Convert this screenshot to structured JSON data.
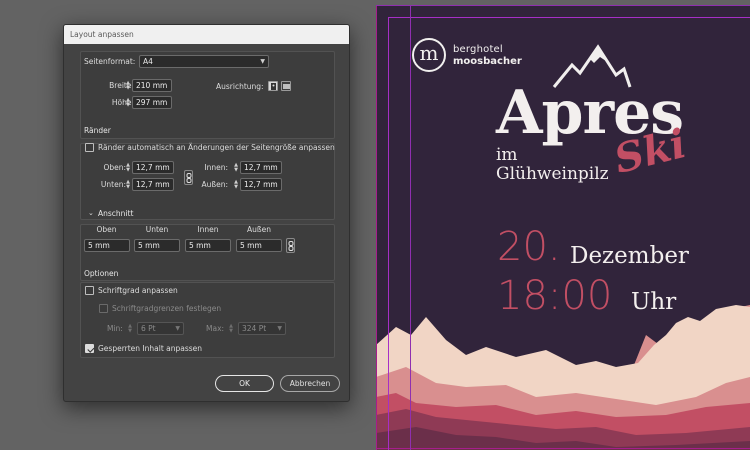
{
  "dialog": {
    "title": "Layout anpassen",
    "format": {
      "label": "Seitenformat:",
      "value": "A4"
    },
    "width": {
      "label": "Breite:",
      "value": "210 mm"
    },
    "height": {
      "label": "Höhe:",
      "value": "297 mm"
    },
    "orientation": {
      "label": "Ausrichtung:"
    },
    "margins": {
      "title": "Ränder",
      "auto_label": "Ränder automatisch an Änderungen der Seitengröße anpassen",
      "auto_checked": false,
      "top": {
        "label": "Oben:",
        "value": "12,7 mm"
      },
      "bottom": {
        "label": "Unten:",
        "value": "12,7 mm"
      },
      "inside": {
        "label": "Innen:",
        "value": "12,7 mm"
      },
      "outside": {
        "label": "Außen:",
        "value": "12,7 mm"
      }
    },
    "bleed": {
      "title": "Anschnitt",
      "headers": [
        "Oben",
        "Unten",
        "Innen",
        "Außen"
      ],
      "values": [
        "5 mm",
        "5 mm",
        "5 mm",
        "5 mm"
      ]
    },
    "options": {
      "title": "Optionen",
      "font_size_label": "Schriftgrad anpassen",
      "font_size_checked": false,
      "font_limit_label": "Schriftgradgrenzen festlegen",
      "min_label": "Min:",
      "min_value": "6 Pt",
      "max_label": "Max:",
      "max_value": "324 Pt",
      "locked_label": "Gesperrten Inhalt anpassen",
      "locked_checked": true
    },
    "ok_label": "OK",
    "cancel_label": "Abbrechen"
  },
  "poster": {
    "logo_mark": "m",
    "logo_line1": "berghotel",
    "logo_line2": "moosbacher",
    "title": "Apres",
    "im": "im",
    "venue": "Glühweinpilz",
    "ski": "Ski",
    "day": "20.",
    "month": "Dezember",
    "time": "18:00",
    "uhr": "Uhr",
    "colors": {
      "background": "#31243b",
      "accent": "#c24f64",
      "cream": "#f1d5c5"
    }
  }
}
